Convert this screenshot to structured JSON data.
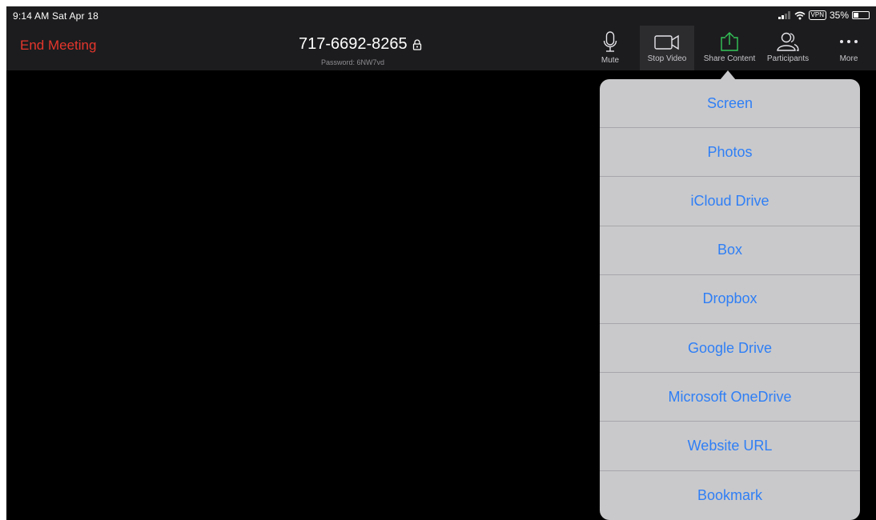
{
  "status_bar": {
    "time_date": "9:14 AM  Sat Apr 18",
    "vpn": "VPN",
    "battery": "35%",
    "battery_level": 0.35
  },
  "toolbar": {
    "end_meeting": "End Meeting",
    "meeting_id": "717-6692-8265",
    "password": "Password: 6NW7vd",
    "buttons": [
      {
        "label": "Mute",
        "icon": "microphone-icon"
      },
      {
        "label": "Stop Video",
        "icon": "video-camera-icon"
      },
      {
        "label": "Share Content",
        "icon": "share-upload-icon"
      },
      {
        "label": "Participants",
        "icon": "participants-icon"
      },
      {
        "label": "More",
        "icon": "more-dots-icon"
      }
    ]
  },
  "share_menu": {
    "items": [
      "Screen",
      "Photos",
      "iCloud Drive",
      "Box",
      "Dropbox",
      "Google Drive",
      "Microsoft OneDrive",
      "Website URL",
      "Bookmark"
    ]
  },
  "colors": {
    "end_meeting": "#e5362c",
    "share_icon": "#34c759",
    "menu_text": "#2f7ff5",
    "popover_bg": "#c9c9cc"
  }
}
